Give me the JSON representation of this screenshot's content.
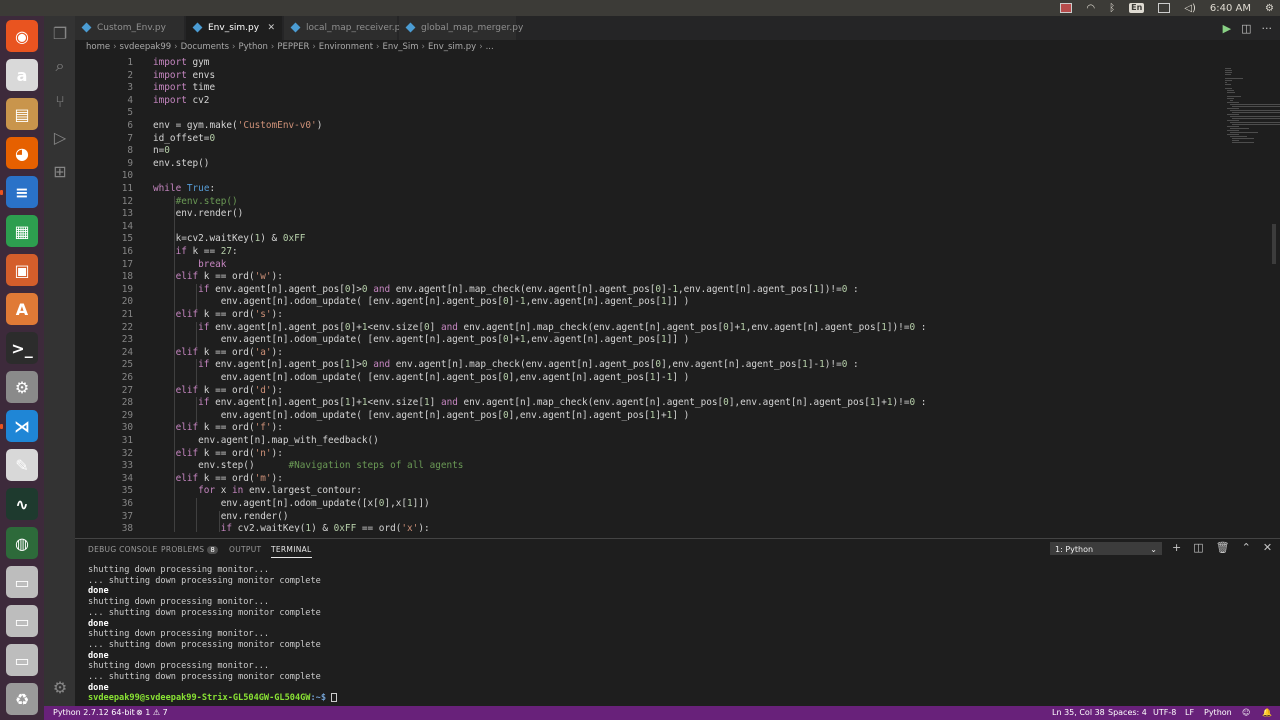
{
  "top_panel": {
    "keyboard": "En",
    "time": "6:40 AM"
  },
  "launcher": {
    "items": [
      {
        "name": "ubuntu-dash-icon",
        "glyph": "◉",
        "color": "#e95420"
      },
      {
        "name": "amazon-icon",
        "glyph": "a",
        "color": "#d9d9d9"
      },
      {
        "name": "files-icon",
        "glyph": "▤",
        "color": "#c9954c"
      },
      {
        "name": "firefox-icon",
        "glyph": "◕",
        "color": "#e66000"
      },
      {
        "name": "writer-icon",
        "glyph": "≡",
        "color": "#2a72c8"
      },
      {
        "name": "calc-icon",
        "glyph": "▦",
        "color": "#2d9e4f"
      },
      {
        "name": "impress-icon",
        "glyph": "▣",
        "color": "#d45e2b"
      },
      {
        "name": "software-center-icon",
        "glyph": "A",
        "color": "#e07a36"
      },
      {
        "name": "terminal-icon",
        "glyph": ">_",
        "color": "#2c2c2c"
      },
      {
        "name": "settings-icon",
        "glyph": "⚙",
        "color": "#8a8a8a"
      },
      {
        "name": "vscode-icon",
        "glyph": "⋊",
        "color": "#1f86d6"
      },
      {
        "name": "text-editor-icon",
        "glyph": "✎",
        "color": "#d8d8d8"
      },
      {
        "name": "system-monitor-icon",
        "glyph": "∿",
        "color": "#1e3a2e"
      },
      {
        "name": "globe-icon",
        "glyph": "◍",
        "color": "#2d6a3a"
      },
      {
        "name": "drive-icon-1",
        "glyph": "▭",
        "color": "#bdbdbd"
      },
      {
        "name": "drive-icon-2",
        "glyph": "▭",
        "color": "#bdbdbd"
      },
      {
        "name": "drive-icon-3",
        "glyph": "▭",
        "color": "#bdbdbd"
      },
      {
        "name": "trash-icon",
        "glyph": "♻",
        "color": "#9a9a9a"
      }
    ]
  },
  "tabs": [
    {
      "label": "Custom_Env.py",
      "active": false
    },
    {
      "label": "Env_sim.py",
      "active": true
    },
    {
      "label": "local_map_receiver.py",
      "active": false
    },
    {
      "label": "global_map_merger.py",
      "active": false
    }
  ],
  "breadcrumb": [
    "home",
    "svdeepak99",
    "Documents",
    "Python",
    "PEPPER",
    "Environment",
    "Env_Sim",
    "Env_sim.py",
    "..."
  ],
  "code_lines": [
    "import gym",
    "import envs",
    "import time",
    "import cv2",
    "",
    "env = gym.make('CustomEnv-v0')",
    "id_offset=0",
    "n=0",
    "env.step()",
    "",
    "while True:",
    "    #env.step()",
    "    env.render()",
    "",
    "    k=cv2.waitKey(1) & 0xFF",
    "    if k == 27:",
    "        break",
    "    elif k == ord('w'):",
    "        if env.agent[n].agent_pos[0]>0 and env.agent[n].map_check(env.agent[n].agent_pos[0]-1,env.agent[n].agent_pos[1])!=0 :",
    "            env.agent[n].odom_update( [env.agent[n].agent_pos[0]-1,env.agent[n].agent_pos[1]] )",
    "    elif k == ord('s'):",
    "        if env.agent[n].agent_pos[0]+1<env.size[0] and env.agent[n].map_check(env.agent[n].agent_pos[0]+1,env.agent[n].agent_pos[1])!=0 :",
    "            env.agent[n].odom_update( [env.agent[n].agent_pos[0]+1,env.agent[n].agent_pos[1]] )",
    "    elif k == ord('a'):",
    "        if env.agent[n].agent_pos[1]>0 and env.agent[n].map_check(env.agent[n].agent_pos[0],env.agent[n].agent_pos[1]-1)!=0 :",
    "            env.agent[n].odom_update( [env.agent[n].agent_pos[0],env.agent[n].agent_pos[1]-1] )",
    "    elif k == ord('d'):",
    "        if env.agent[n].agent_pos[1]+1<env.size[1] and env.agent[n].map_check(env.agent[n].agent_pos[0],env.agent[n].agent_pos[1]+1)!=0 :",
    "            env.agent[n].odom_update( [env.agent[n].agent_pos[0],env.agent[n].agent_pos[1]+1] )",
    "    elif k == ord('f'):",
    "        env.agent[n].map_with_feedback()",
    "    elif k == ord('n'):",
    "        env.step()      #Navigation steps of all agents",
    "    elif k == ord('m'):",
    "        for x in env.largest_contour:",
    "            env.agent[n].odom_update([x[0],x[1]])",
    "            env.render()",
    "            if cv2.waitKey(1) & 0xFF == ord('x'):"
  ],
  "panel": {
    "tabs": [
      {
        "label": "DEBUG CONSOLE",
        "active": false
      },
      {
        "label": "PROBLEMS",
        "active": false,
        "badge": "8"
      },
      {
        "label": "OUTPUT",
        "active": false
      },
      {
        "label": "TERMINAL",
        "active": true
      }
    ],
    "terminal_selector": "1: Python",
    "terminal_lines": [
      {
        "text": "shutting down processing monitor...",
        "bold": false
      },
      {
        "text": "... shutting down processing monitor complete",
        "bold": false
      },
      {
        "text": "done",
        "bold": true
      },
      {
        "text": "shutting down processing monitor...",
        "bold": false
      },
      {
        "text": "... shutting down processing monitor complete",
        "bold": false
      },
      {
        "text": "done",
        "bold": true
      },
      {
        "text": "shutting down processing monitor...",
        "bold": false
      },
      {
        "text": "... shutting down processing monitor complete",
        "bold": false
      },
      {
        "text": "done",
        "bold": true
      },
      {
        "text": "shutting down processing monitor...",
        "bold": false
      },
      {
        "text": "... shutting down processing monitor complete",
        "bold": false
      },
      {
        "text": "done",
        "bold": true
      }
    ],
    "prompt_user": "svdeepak99@svdeepak99-Strix-GL504GW-GL504GW",
    "prompt_path": ":~$ "
  },
  "statusbar": {
    "interpreter": "Python 2.7.12 64-bit",
    "problems": "⊗ 1 ⚠ 7",
    "position": "Ln 35, Col 38",
    "spaces": "Spaces: 4",
    "encoding": "UTF-8",
    "eol": "LF",
    "language": "Python",
    "color": "#68217a"
  }
}
